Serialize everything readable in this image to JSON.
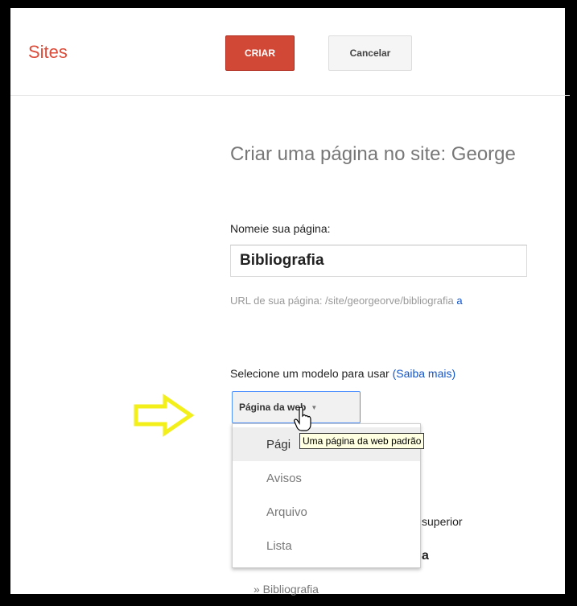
{
  "header": {
    "app_name": "Sites",
    "create_label": "CRIAR",
    "cancel_label": "Cancelar"
  },
  "main": {
    "title": "Criar uma página no site: George",
    "name_label": "Nomeie sua página:",
    "name_value": "Bibliografia",
    "url_prefix": "URL de sua página: /site/georgeorve/bibliografia",
    "url_link": "a",
    "template_label": "Selecione um modelo para usar",
    "template_link": "(Saiba mais)",
    "template_selected": "Página da web",
    "template_options": [
      "Pági",
      "Avisos",
      "Arquivo",
      "Lista"
    ],
    "tooltip": "Uma página da web padrão",
    "partial_superior": "superior",
    "partial_a": "a",
    "bib_item": "» Bibliografia"
  },
  "icons": {
    "arrow": "right-arrow-icon",
    "cursor": "hand-pointer-icon",
    "dropdown": "triangle-down-icon"
  },
  "colors": {
    "brand": "#dd4b39",
    "create_button": "#d14836",
    "link": "#1155cc",
    "arrow": "#f3ef1a"
  }
}
